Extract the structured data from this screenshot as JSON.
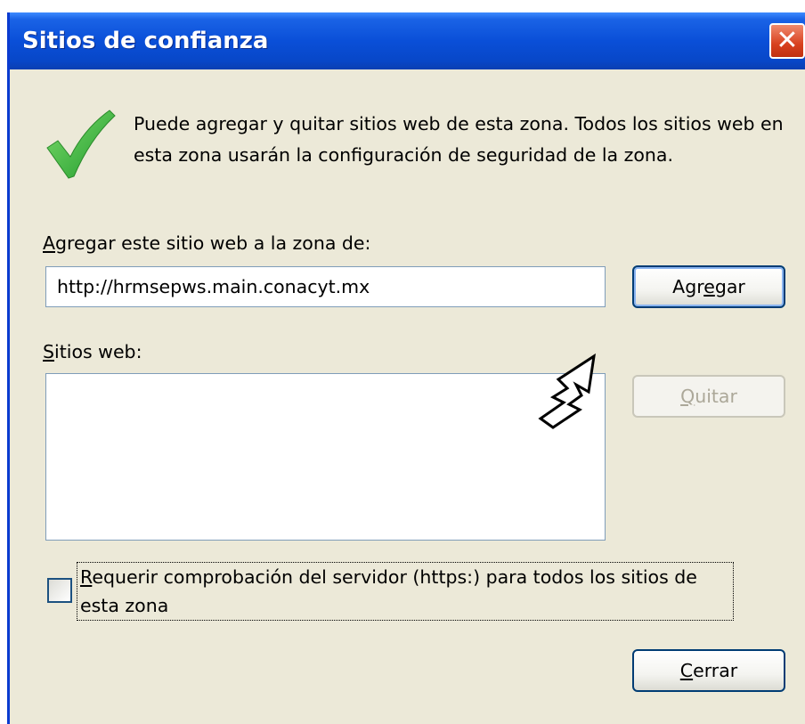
{
  "window": {
    "title": "Sitios de confianza",
    "close_glyph": "✕"
  },
  "intro": {
    "icon": "checkmark-icon",
    "text": "Puede agregar y quitar sitios web de esta zona. Todos los sitios web en esta zona usarán la configuración de seguridad de la zona."
  },
  "add_site": {
    "label_pre": "A",
    "label_rest": "gregar este sitio web a la zona de:",
    "value": "http://hrmsepws.main.conacyt.mx",
    "button_pre": "Agr",
    "button_mnemonic": "e",
    "button_post": "gar"
  },
  "sites": {
    "label_mnemonic": "S",
    "label_rest": "itios web:",
    "items": [],
    "remove_mnemonic": "Q",
    "remove_rest": "uitar"
  },
  "https_option": {
    "checked": false,
    "label_mnemonic": "R",
    "label_rest": "equerir comprobación del servidor (https:) para todos los sitios de esta zona"
  },
  "footer": {
    "close_mnemonic": "C",
    "close_rest": "errar"
  },
  "colors": {
    "titlebar": "#0a4fd8",
    "dialog_bg": "#ece9d8",
    "close_button": "#d8411f",
    "check_green": "#3cb83c"
  },
  "cursor": "hand-pointer-icon"
}
